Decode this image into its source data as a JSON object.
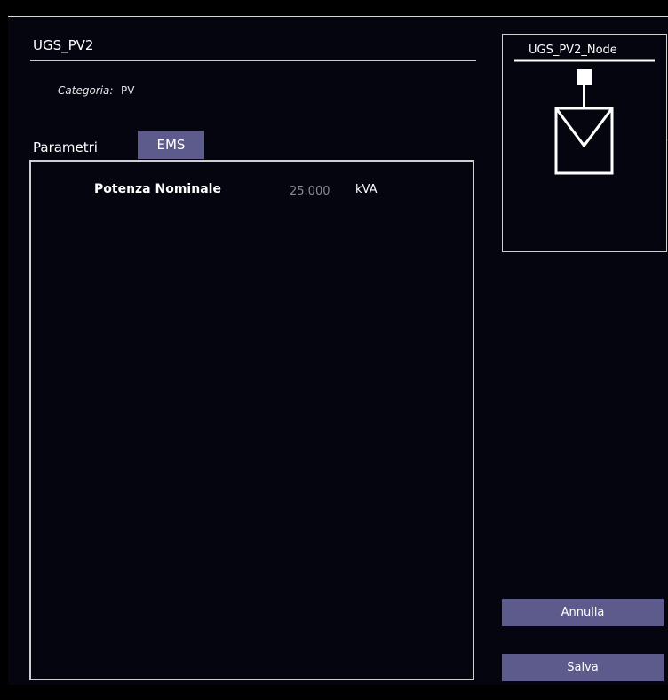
{
  "header": {
    "title": "UGS_PV2",
    "category_label": "Categoria:",
    "category_value": "PV"
  },
  "tabs": [
    {
      "label": "Parametri",
      "active": false
    },
    {
      "label": "EMS",
      "active": true
    }
  ],
  "fields": {
    "potenza_nominale": {
      "label": "Potenza Nominale",
      "value": "25.000",
      "unit": "kVA"
    }
  },
  "node": {
    "name": "UGS_PV2_Node",
    "icon": "pv-generator-icon"
  },
  "buttons": {
    "cancel_label": "Annulla",
    "save_label": "Salva"
  },
  "colors": {
    "background": "#05050f",
    "accent": "#5d5a8c",
    "border": "#d0d0d0",
    "value_gray": "#8a8a8a"
  }
}
